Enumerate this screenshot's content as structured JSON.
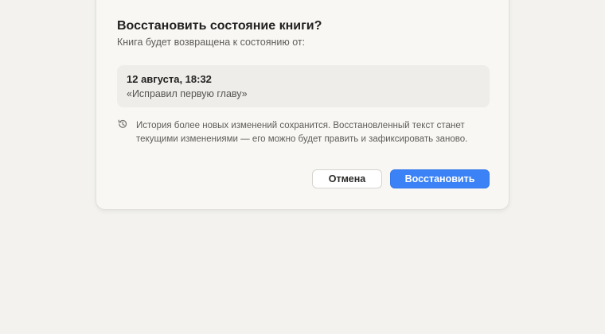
{
  "dialog": {
    "title": "Восстановить состояние книги?",
    "subtitle": "Книга будет возвращена к состоянию от:",
    "snapshot": {
      "date": "12 августа, 18:32",
      "message": "«Исправил первую главу»"
    },
    "note": {
      "icon": "history-icon",
      "text": "История более новых изменений сохранится. Восстановленный текст станет текущими изменениями — его можно будет править и зафиксировать заново."
    },
    "buttons": {
      "cancel_label": "Отмена",
      "restore_label": "Восстановить"
    }
  },
  "colors": {
    "background": "#f3f2ef",
    "dialog": "#f8f7f4",
    "card": "#eeede9",
    "accent": "#3b82f6"
  }
}
